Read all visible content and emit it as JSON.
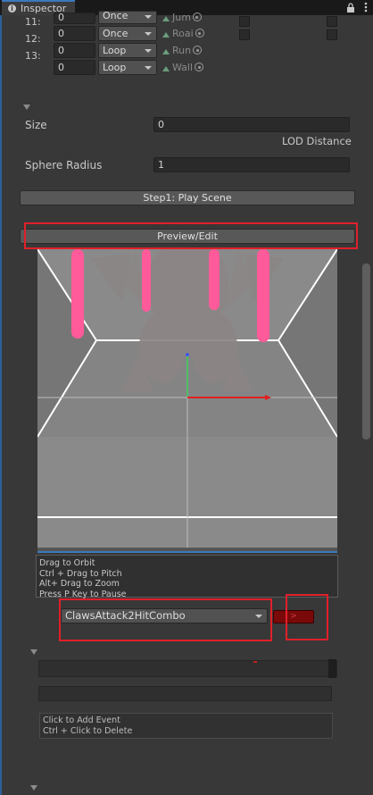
{
  "window": {
    "tab_title": "Inspector",
    "tab_icon": "info-icon",
    "header_icons": [
      "lock-icon",
      "more-options-icon"
    ]
  },
  "animation_list": {
    "rows": [
      {
        "index": "11:",
        "value": "0",
        "mode": "Once",
        "clip": "Jum"
      },
      {
        "index": "12:",
        "value": "0",
        "mode": "Once",
        "clip": "Roai"
      },
      {
        "index": "13:",
        "value": "0",
        "mode": "Loop",
        "clip": "Run"
      },
      {
        "index": "",
        "value": "0",
        "mode": "Loop",
        "clip": "Wall"
      }
    ]
  },
  "lod": {
    "size_label": "Size",
    "size_value": "0",
    "lod_distance_label": "LOD Distance",
    "sphere_radius_label": "Sphere Radius",
    "sphere_radius_value": "1"
  },
  "buttons": {
    "step1": "Step1: Play Scene",
    "preview_edit": "Preview/Edit",
    "next": ">"
  },
  "preview": {
    "help_lines": [
      "Drag to Orbit",
      "Ctrl + Drag to Pitch",
      "Alt+ Drag to Zoom",
      "Press P Key to Pause"
    ]
  },
  "clip_select": {
    "selected": "ClawsAttack2HitCombo"
  },
  "events": {
    "help_lines": [
      "Click to Add Event",
      "Ctrl + Click to Delete"
    ]
  },
  "colors": {
    "accent_blue": "#3a79bb",
    "highlight_red": "#e0202a",
    "next_button_red": "#7a0a0a",
    "glow_pink": "#ff5a9a"
  }
}
